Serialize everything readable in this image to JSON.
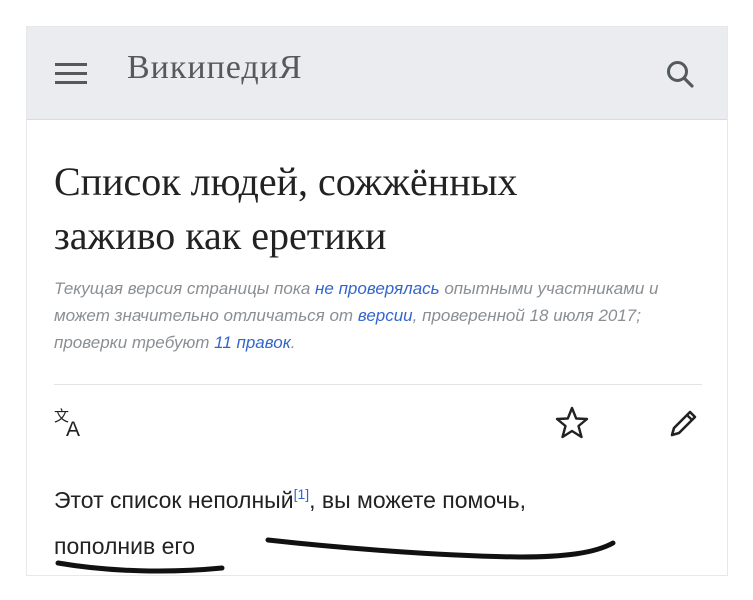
{
  "header": {
    "menu_icon": "hamburger-menu-icon",
    "logo": "ВикипедиЯ",
    "search_icon": "search-icon"
  },
  "article": {
    "title_line1": "Список людей, сожжённых",
    "title_line2": "заживо как еретики",
    "revision_notice": {
      "text1": "Текущая версия страницы пока ",
      "link1": "не проверялась",
      "text2": " опытными участниками и может значительно отличаться от ",
      "link2": "версии",
      "text3": ", проверенной 18 июля 2017; проверки требуют ",
      "link3": "11 правок",
      "text4": "."
    }
  },
  "actions": {
    "language_icon": "language-icon",
    "watch_icon": "star-icon",
    "edit_icon": "pencil-icon"
  },
  "notice": {
    "text_before": "Этот список неполный",
    "ref": "[1]",
    "text_after": ", вы можете помочь,",
    "link": "пополнив его"
  },
  "colors": {
    "header_bg": "#eaecf0",
    "link": "#3366cc",
    "text": "#222222",
    "muted": "#8a8f94"
  }
}
